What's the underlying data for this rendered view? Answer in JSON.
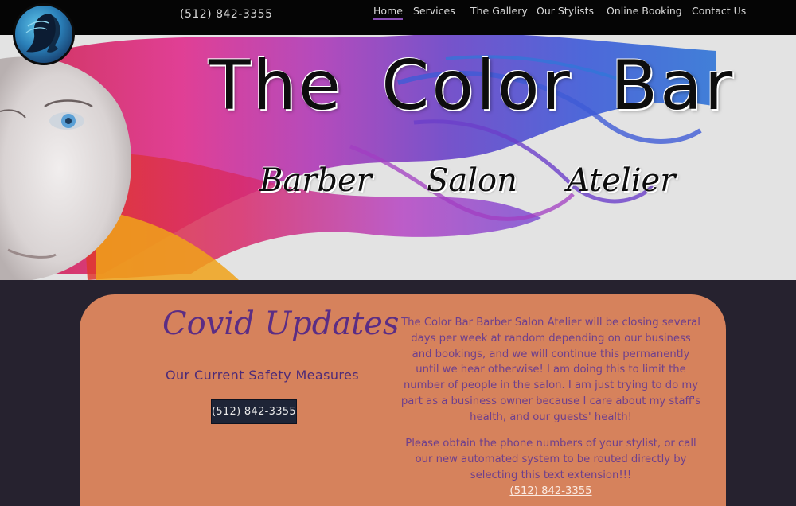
{
  "header": {
    "phone": "(512) 842-3355",
    "nav": [
      {
        "label": "Home",
        "active": true
      },
      {
        "label": "Services",
        "active": false
      },
      {
        "label": "The Gallery",
        "active": false
      },
      {
        "label": "Our Stylists",
        "active": false
      },
      {
        "label": "Online Booking",
        "active": false
      },
      {
        "label": "Contact Us",
        "active": false
      }
    ],
    "logo_icon": "woman-profile-logo-icon"
  },
  "hero": {
    "title": "The Color Bar",
    "taglines": [
      "Barber",
      "Salon",
      "Atelier"
    ]
  },
  "covid": {
    "title": "Covid Updates",
    "subtitle": "Our Current Safety Measures",
    "button_label": "(512) 842-3355",
    "paragraph1": "The Color Bar Barber Salon Atelier will be closing several days per week at random depending on our business and bookings, and we will continue this permanently until we hear otherwise! I am doing this to limit the number of people in the salon. I am just trying to do my part as a business owner because I care about my staff's health, and our guests' health!",
    "paragraph2": "Please obtain the phone numbers of your stylist, or call our new automated system to be routed directly by selecting this text extension!!!",
    "extension_link": "(512) 842-3355"
  },
  "colors": {
    "topbar": "#050505",
    "card": "#d6825c",
    "title_purple": "#5b2d84",
    "page_bg": "#26222f",
    "nav_active_underline": "#8a4fb5"
  }
}
